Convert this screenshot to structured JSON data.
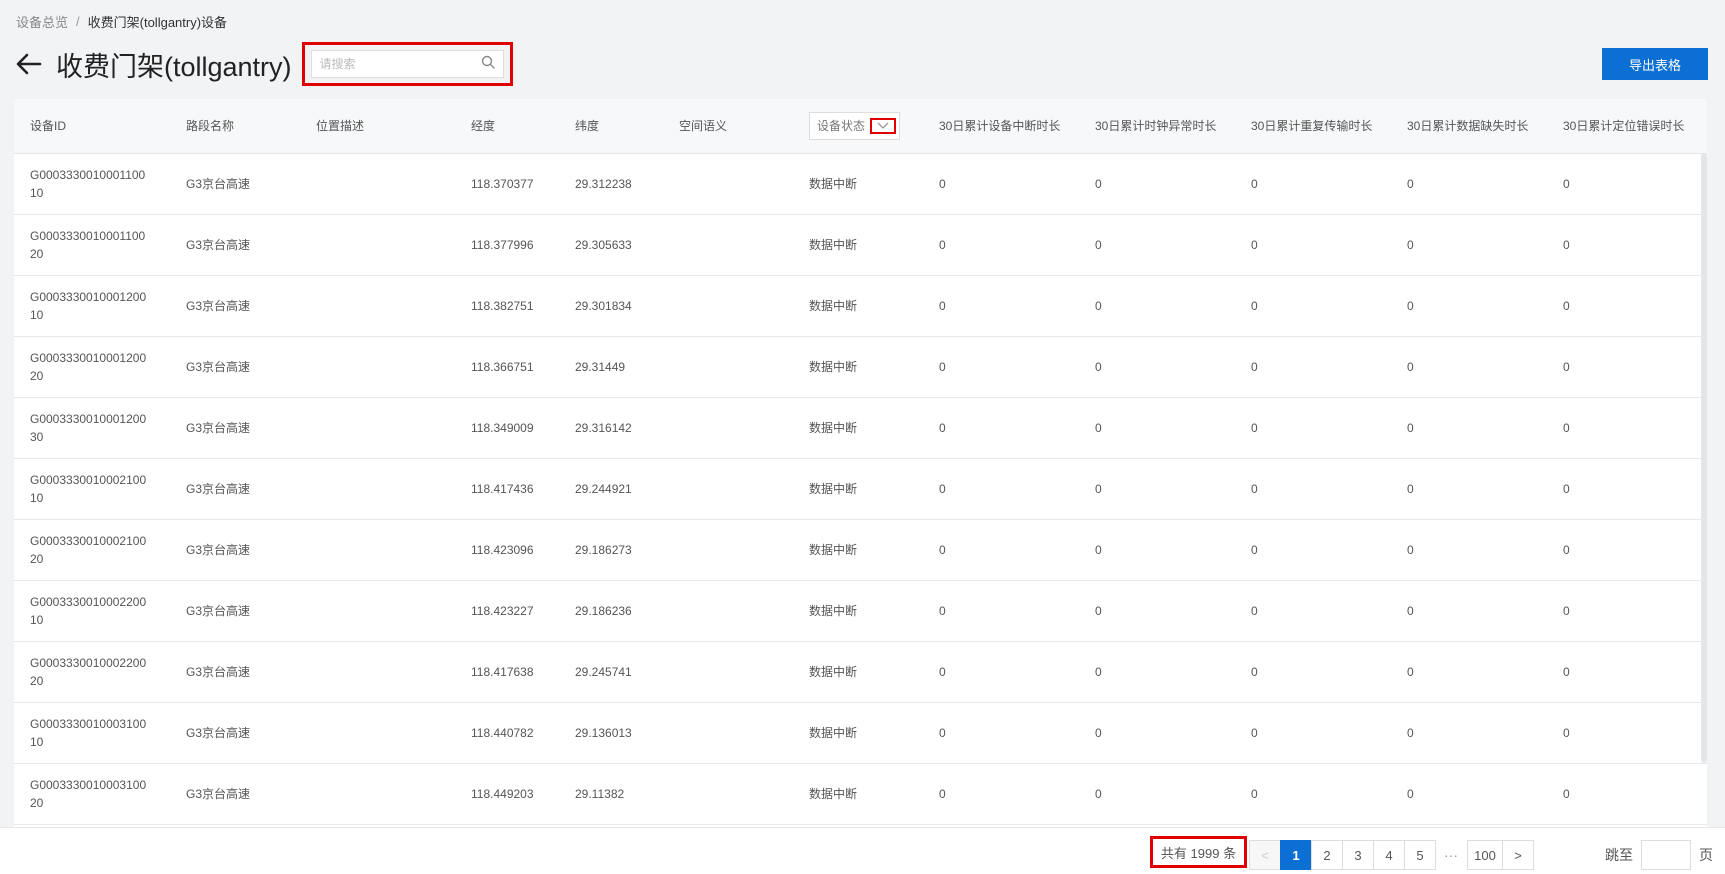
{
  "breadcrumb": {
    "root": "设备总览",
    "sep": "/",
    "current": "收费门架(tollgantry)设备"
  },
  "header": {
    "title": "收费门架(tollgantry)",
    "search_placeholder": "请搜索",
    "export_label": "导出表格"
  },
  "table": {
    "columns": [
      "设备ID",
      "路段名称",
      "位置描述",
      "经度",
      "纬度",
      "空间语义",
      "设备状态",
      "30日累计设备中断时长",
      "30日累计时钟异常时长",
      "30日累计重复传输时长",
      "30日累计数据缺失时长",
      "30日累计定位错误时长"
    ],
    "rows": [
      {
        "id": "G000333001000110010",
        "road": "G3京台高速",
        "loc": "",
        "lng": "118.370377",
        "lat": "29.312238",
        "sem": "",
        "status": "数据中断",
        "m1": "0",
        "m2": "0",
        "m3": "0",
        "m4": "0",
        "m5": "0"
      },
      {
        "id": "G000333001000110020",
        "road": "G3京台高速",
        "loc": "",
        "lng": "118.377996",
        "lat": "29.305633",
        "sem": "",
        "status": "数据中断",
        "m1": "0",
        "m2": "0",
        "m3": "0",
        "m4": "0",
        "m5": "0"
      },
      {
        "id": "G000333001000120010",
        "road": "G3京台高速",
        "loc": "",
        "lng": "118.382751",
        "lat": "29.301834",
        "sem": "",
        "status": "数据中断",
        "m1": "0",
        "m2": "0",
        "m3": "0",
        "m4": "0",
        "m5": "0"
      },
      {
        "id": "G000333001000120020",
        "road": "G3京台高速",
        "loc": "",
        "lng": "118.366751",
        "lat": "29.31449",
        "sem": "",
        "status": "数据中断",
        "m1": "0",
        "m2": "0",
        "m3": "0",
        "m4": "0",
        "m5": "0"
      },
      {
        "id": "G000333001000120030",
        "road": "G3京台高速",
        "loc": "",
        "lng": "118.349009",
        "lat": "29.316142",
        "sem": "",
        "status": "数据中断",
        "m1": "0",
        "m2": "0",
        "m3": "0",
        "m4": "0",
        "m5": "0"
      },
      {
        "id": "G000333001000210010",
        "road": "G3京台高速",
        "loc": "",
        "lng": "118.417436",
        "lat": "29.244921",
        "sem": "",
        "status": "数据中断",
        "m1": "0",
        "m2": "0",
        "m3": "0",
        "m4": "0",
        "m5": "0"
      },
      {
        "id": "G000333001000210020",
        "road": "G3京台高速",
        "loc": "",
        "lng": "118.423096",
        "lat": "29.186273",
        "sem": "",
        "status": "数据中断",
        "m1": "0",
        "m2": "0",
        "m3": "0",
        "m4": "0",
        "m5": "0"
      },
      {
        "id": "G000333001000220010",
        "road": "G3京台高速",
        "loc": "",
        "lng": "118.423227",
        "lat": "29.186236",
        "sem": "",
        "status": "数据中断",
        "m1": "0",
        "m2": "0",
        "m3": "0",
        "m4": "0",
        "m5": "0"
      },
      {
        "id": "G000333001000220020",
        "road": "G3京台高速",
        "loc": "",
        "lng": "118.417638",
        "lat": "29.245741",
        "sem": "",
        "status": "数据中断",
        "m1": "0",
        "m2": "0",
        "m3": "0",
        "m4": "0",
        "m5": "0"
      },
      {
        "id": "G000333001000310010",
        "road": "G3京台高速",
        "loc": "",
        "lng": "118.440782",
        "lat": "29.136013",
        "sem": "",
        "status": "数据中断",
        "m1": "0",
        "m2": "0",
        "m3": "0",
        "m4": "0",
        "m5": "0"
      },
      {
        "id": "G000333001000310020",
        "road": "G3京台高速",
        "loc": "",
        "lng": "118.449203",
        "lat": "29.11382",
        "sem": "",
        "status": "数据中断",
        "m1": "0",
        "m2": "0",
        "m3": "0",
        "m4": "0",
        "m5": "0"
      }
    ]
  },
  "pagination": {
    "total_label": "共有 1999 条",
    "prev": "<",
    "next": ">",
    "pages": [
      "1",
      "2",
      "3",
      "4",
      "5"
    ],
    "ellipsis": "···",
    "last": "100",
    "jump_label": "跳至",
    "page_unit": "页"
  },
  "colors": {
    "accent": "#0b6fd3",
    "highlight": "#e00000",
    "background": "#f2f3f5"
  },
  "icons": {
    "back": "arrow-left-icon",
    "search": "search-icon",
    "filter": "chevron-down-icon"
  }
}
